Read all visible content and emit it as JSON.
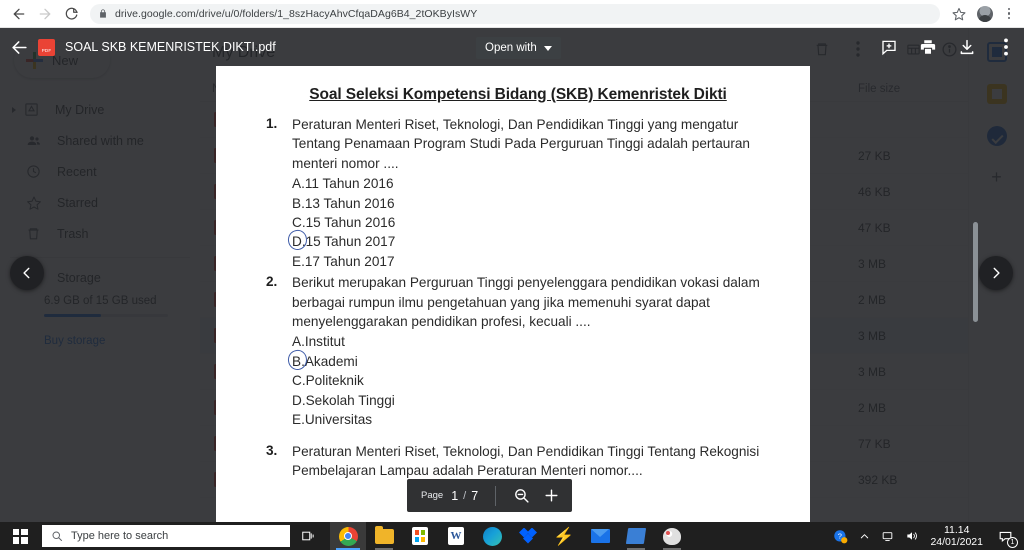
{
  "browser": {
    "url": "drive.google.com/drive/u/0/folders/1_8szHacyAhvCfqaDAg6B4_2tOKByIsWY",
    "back_icon": "back-arrow-icon",
    "forward_icon": "forward-arrow-icon",
    "reload_icon": "reload-icon",
    "lock_icon": "lock-icon",
    "bookmark_icon": "star-icon",
    "profile_icon": "avatar-icon",
    "menu_icon": "chrome-menu-icon"
  },
  "drive": {
    "new_button": "New",
    "sidebar_items": [
      {
        "label": "My Drive",
        "icon": "drive-icon",
        "expandable": true
      },
      {
        "label": "Shared with me",
        "icon": "people-icon",
        "expandable": false
      },
      {
        "label": "Recent",
        "icon": "clock-icon",
        "expandable": false
      },
      {
        "label": "Starred",
        "icon": "star-outline-icon",
        "expandable": false
      },
      {
        "label": "Trash",
        "icon": "trash-icon",
        "expandable": false
      },
      {
        "label": "Storage",
        "icon": "storage-icon",
        "expandable": false
      }
    ],
    "storage_text": "6.9 GB of 15 GB used",
    "storage_percent": 46,
    "buy_storage": "Buy storage",
    "main_title": "My Drive",
    "columns": {
      "name": "Name",
      "size": "File size"
    },
    "toolbar_icons": [
      "trash-icon",
      "more-options-icon",
      "grid-view-icon",
      "info-icon"
    ],
    "files": [
      {
        "name": "",
        "size": ""
      },
      {
        "name": "",
        "size": "27 KB"
      },
      {
        "name": "",
        "size": "46 KB"
      },
      {
        "name": "",
        "size": "47 KB"
      },
      {
        "name": "",
        "size": "3 MB"
      },
      {
        "name": "",
        "size": "2 MB"
      },
      {
        "name": "",
        "size": "3 MB",
        "selected": true
      },
      {
        "name": "",
        "size": "3 MB"
      },
      {
        "name": "",
        "size": "2 MB"
      },
      {
        "name": "",
        "size": "77 KB"
      },
      {
        "name": "",
        "size": "392 KB"
      }
    ],
    "rail_icons": [
      "calendar-icon",
      "keep-icon",
      "tasks-icon",
      "add-app-icon"
    ]
  },
  "viewer": {
    "back_icon": "back-arrow-icon",
    "file_icon": "pdf-file-icon",
    "file_name": "SOAL SKB KEMENRISTEK DIKTI.pdf",
    "open_with_label": "Open with",
    "add_comment_icon": "add-comment-icon",
    "print_icon": "print-icon",
    "download_icon": "download-icon",
    "more_icon": "more-options-icon",
    "prev_page_icon": "chevron-left-icon",
    "next_page_icon": "chevron-right-icon",
    "page_label": "Page",
    "current_page": "1",
    "separator": "/",
    "total_pages": "7",
    "zoom_out_icon": "zoom-out-icon",
    "zoom_in_icon": "zoom-in-icon"
  },
  "document": {
    "title": "Soal Seleksi Kompetensi Bidang (SKB) Kemenristek Dikti",
    "annotation_color": "#2f4ea1",
    "questions": [
      {
        "number": "1.",
        "text": "Peraturan Menteri Riset, Teknologi, Dan Pendidikan Tinggi yang mengatur Tentang Penamaan Program Studi Pada Perguruan Tinggi adalah pertauran menteri nomor ....",
        "options": [
          {
            "letter": "A.",
            "text": "11 Tahun 2016",
            "circled": false
          },
          {
            "letter": "B.",
            "text": "13 Tahun 2016",
            "circled": false
          },
          {
            "letter": "C.",
            "text": "15 Tahun 2016",
            "circled": false
          },
          {
            "letter": "D.",
            "text": "15 Tahun 2017",
            "circled": true
          },
          {
            "letter": "E.",
            "text": "17 Tahun 2017",
            "circled": false
          }
        ]
      },
      {
        "number": "2.",
        "text": "Berikut merupakan Perguruan Tinggi penyelenggara pendidikan vokasi dalam berbagai rumpun ilmu pengetahuan yang jika memenuhi syarat dapat menyelenggarakan pendidikan profesi, kecuali ....",
        "options": [
          {
            "letter": "A.",
            "text": "Institut",
            "circled": false
          },
          {
            "letter": "B.",
            "text": "Akademi",
            "circled": true
          },
          {
            "letter": "C.",
            "text": "Politeknik",
            "circled": false
          },
          {
            "letter": "D.",
            "text": "Sekolah Tinggi",
            "circled": false
          },
          {
            "letter": "E.",
            "text": "Universitas",
            "circled": false
          }
        ]
      },
      {
        "number": "3.",
        "text": "Peraturan Menteri Riset, Teknologi, Dan Pendidikan Tinggi Tentang Rekognisi Pembelajaran Lampau adalah Peraturan Menteri nomor....",
        "options": []
      }
    ]
  },
  "taskbar": {
    "start_icon": "windows-start-icon",
    "search_placeholder": "Type here to search",
    "search_icon": "search-icon",
    "task_view_icon": "task-view-icon",
    "apps": [
      {
        "name": "chrome-icon",
        "state": "active"
      },
      {
        "name": "file-explorer-icon",
        "state": "open"
      },
      {
        "name": "microsoft-store-icon",
        "state": "idle"
      },
      {
        "name": "word-icon",
        "state": "idle"
      },
      {
        "name": "edge-icon",
        "state": "idle"
      },
      {
        "name": "dropbox-icon",
        "state": "idle"
      },
      {
        "name": "bolt-icon",
        "state": "idle"
      },
      {
        "name": "mail-icon",
        "state": "idle"
      },
      {
        "name": "books-icon",
        "state": "open"
      },
      {
        "name": "paint-icon",
        "state": "open"
      }
    ],
    "tray_icons": [
      "help-icon",
      "show-hidden-icons-icon",
      "network-icon",
      "volume-icon"
    ],
    "time": "11.14",
    "date": "24/01/2021",
    "notification_count": "1",
    "notification_icon": "notifications-icon"
  }
}
